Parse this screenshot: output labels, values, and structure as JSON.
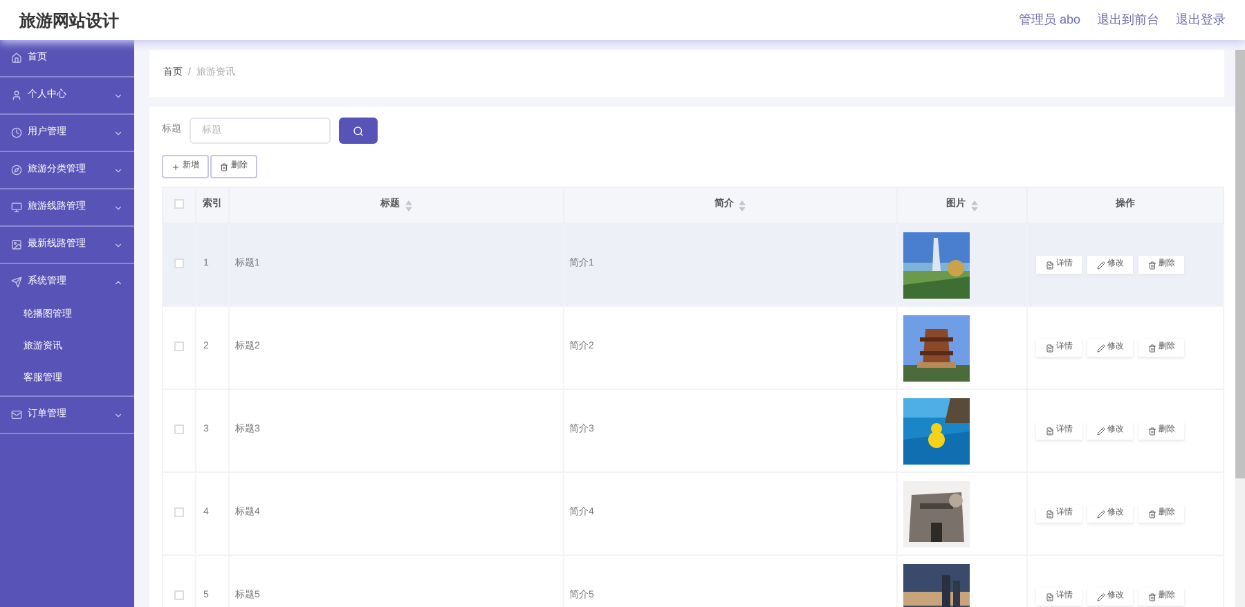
{
  "header": {
    "title": "旅游网站设计",
    "links": [
      "管理员 abo",
      "退出到前台",
      "退出登录"
    ]
  },
  "sidebar": {
    "items": [
      {
        "label": "首页",
        "kind": "link"
      },
      {
        "label": "个人中心",
        "kind": "menu",
        "expanded": false
      },
      {
        "label": "用户管理",
        "kind": "menu",
        "expanded": false
      },
      {
        "label": "旅游分类管理",
        "kind": "menu",
        "expanded": false
      },
      {
        "label": "旅游线路管理",
        "kind": "menu",
        "expanded": false
      },
      {
        "label": "最新线路管理",
        "kind": "menu",
        "expanded": false
      },
      {
        "label": "系统管理",
        "kind": "menu",
        "expanded": true,
        "children": [
          {
            "label": "轮播图管理"
          },
          {
            "label": "旅游资讯"
          },
          {
            "label": "客服管理"
          }
        ]
      },
      {
        "label": "订单管理",
        "kind": "menu",
        "expanded": false
      }
    ]
  },
  "breadcrumb": {
    "items": [
      "首页",
      "旅游资讯"
    ],
    "separator": "/"
  },
  "search": {
    "label": "标题",
    "placeholder": "标题"
  },
  "toolbar": [
    "新增",
    "删除"
  ],
  "table": {
    "select_all": {
      "checked": false
    },
    "columns": [
      {
        "label": "索引",
        "sortable": false
      },
      {
        "label": "标题",
        "sortable": true
      },
      {
        "label": "简介",
        "sortable": true
      },
      {
        "label": "图片",
        "sortable": true
      },
      {
        "label": "操作",
        "sortable": false
      }
    ],
    "rows": [
      {
        "index": "1",
        "title": "标题1",
        "intro": "简介1",
        "checked": false,
        "highlighted": true,
        "actions": [
          "详情",
          "修改",
          "删除"
        ]
      },
      {
        "index": "2",
        "title": "标题2",
        "intro": "简介2",
        "checked": false,
        "highlighted": false,
        "actions": [
          "详情",
          "修改",
          "删除"
        ]
      },
      {
        "index": "3",
        "title": "标题3",
        "intro": "简介3",
        "checked": false,
        "highlighted": false,
        "actions": [
          "详情",
          "修改",
          "删除"
        ]
      },
      {
        "index": "4",
        "title": "标题4",
        "intro": "简介4",
        "checked": false,
        "highlighted": false,
        "actions": [
          "详情",
          "修改",
          "删除"
        ]
      },
      {
        "index": "5",
        "title": "标题5",
        "intro": "简介5",
        "checked": false,
        "highlighted": false,
        "actions": [
          "详情",
          "修改",
          "删除"
        ]
      }
    ]
  }
}
